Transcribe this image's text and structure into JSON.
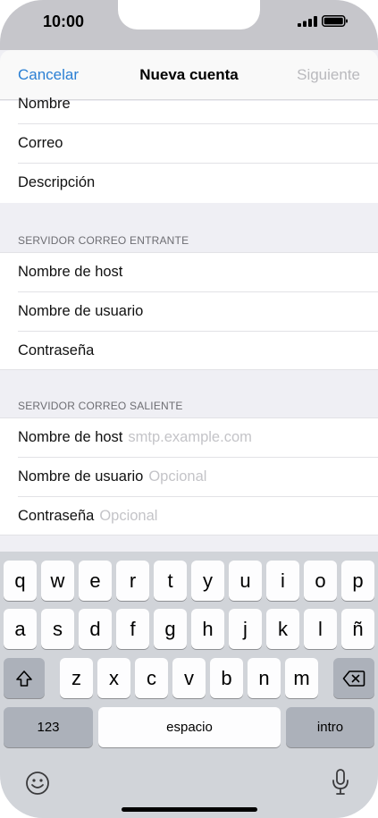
{
  "status": {
    "time": "10:00"
  },
  "nav": {
    "cancel": "Cancelar",
    "title": "Nueva cuenta",
    "next": "Siguiente"
  },
  "account": [
    {
      "label": "Nombre"
    },
    {
      "label": "Correo"
    },
    {
      "label": "Descripción"
    }
  ],
  "incoming": {
    "header": "SERVIDOR CORREO ENTRANTE",
    "rows": [
      {
        "label": "Nombre de host"
      },
      {
        "label": "Nombre de usuario"
      },
      {
        "label": "Contraseña"
      }
    ]
  },
  "outgoing": {
    "header": "SERVIDOR CORREO SALIENTE",
    "rows": [
      {
        "label": "Nombre de host",
        "placeholder": "smtp.example.com"
      },
      {
        "label": "Nombre de usuario",
        "placeholder": "Opcional"
      },
      {
        "label": "Contraseña",
        "placeholder": "Opcional"
      }
    ]
  },
  "keyboard": {
    "row1": [
      "q",
      "w",
      "e",
      "r",
      "t",
      "y",
      "u",
      "i",
      "o",
      "p"
    ],
    "row2": [
      "a",
      "s",
      "d",
      "f",
      "g",
      "h",
      "j",
      "k",
      "l",
      "ñ"
    ],
    "row3": [
      "z",
      "x",
      "c",
      "v",
      "b",
      "n",
      "m"
    ],
    "numbers": "123",
    "space": "espacio",
    "return": "intro",
    "icons": [
      "shift-icon",
      "delete-icon",
      "emoji-icon",
      "microphone-icon"
    ]
  }
}
